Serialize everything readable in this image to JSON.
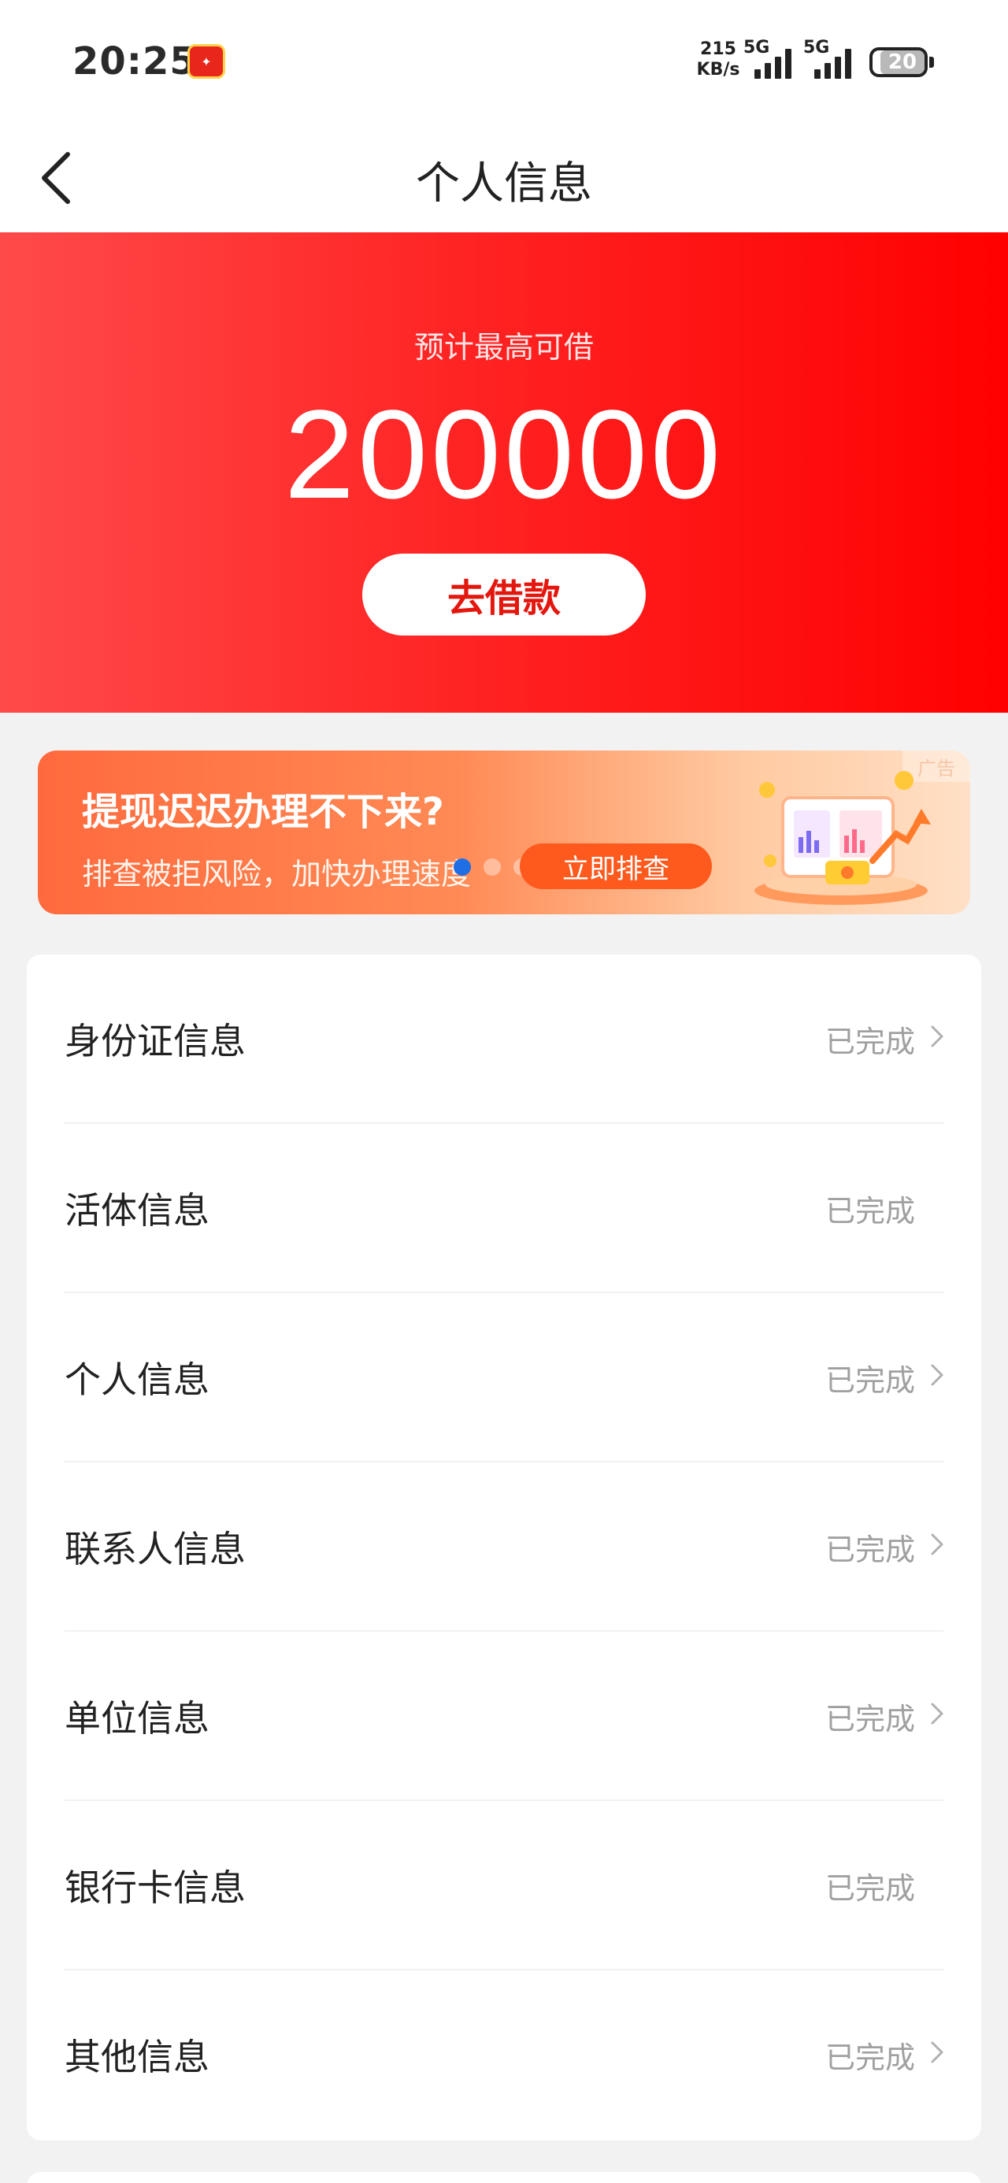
{
  "status_bar": {
    "time": "20:25",
    "net_speed_value": "215",
    "net_speed_unit": "KB/s",
    "signal1_label": "5G",
    "signal2_label": "5G",
    "battery_level": "20"
  },
  "header": {
    "title": "个人信息"
  },
  "hero": {
    "label": "预计最高可借",
    "amount": "200000",
    "button_label": "去借款"
  },
  "ad": {
    "title": "提现迟迟办理不下来?",
    "subtitle": "排查被拒风险，加快办理速度",
    "cta_label": "立即排查",
    "tag": "广告"
  },
  "info_list": [
    {
      "label": "身份证信息",
      "status": "已完成",
      "has_chevron": true
    },
    {
      "label": "活体信息",
      "status": "已完成",
      "has_chevron": false
    },
    {
      "label": "个人信息",
      "status": "已完成",
      "has_chevron": true
    },
    {
      "label": "联系人信息",
      "status": "已完成",
      "has_chevron": true
    },
    {
      "label": "单位信息",
      "status": "已完成",
      "has_chevron": true
    },
    {
      "label": "银行卡信息",
      "status": "已完成",
      "has_chevron": false
    },
    {
      "label": "其他信息",
      "status": "已完成",
      "has_chevron": true
    }
  ],
  "colors": {
    "brand_red": "#ff1a1a",
    "button_text": "#e4170f",
    "status_gray": "#a0a0a0"
  }
}
